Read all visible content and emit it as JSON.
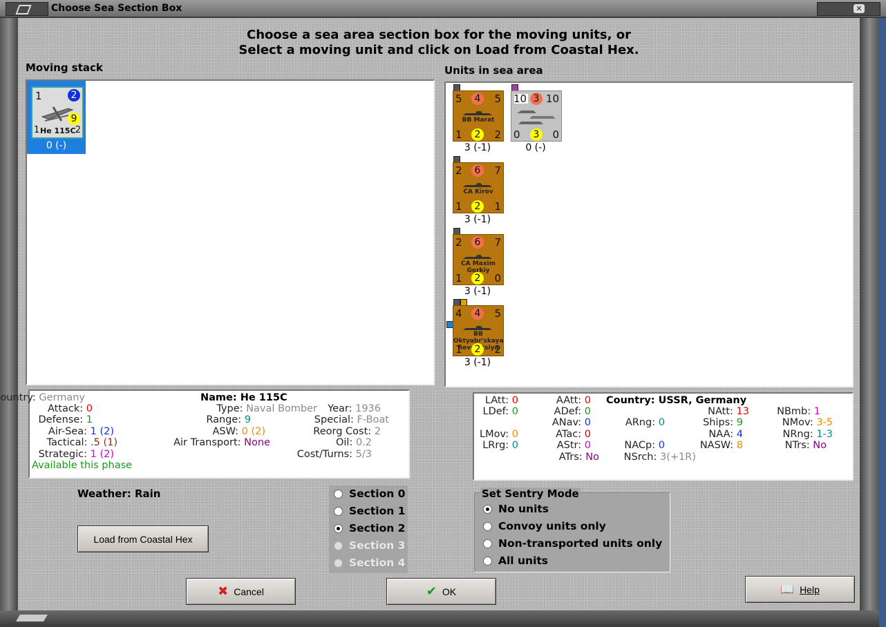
{
  "window": {
    "title": "Choose Sea Section Box"
  },
  "instructions": {
    "line1": "Choose a sea area section box for the moving units, or",
    "line2": "Select a moving unit and click on Load from Coastal Hex."
  },
  "moving_stack": {
    "label": "Moving stack",
    "unit": {
      "top_left": "1",
      "top_right": "2",
      "mid": "9",
      "bottom_left": "1",
      "name": "He 115C",
      "bottom_right": "2",
      "caption": "0 (-)"
    }
  },
  "sea_area": {
    "label": "Units in sea area",
    "units": [
      {
        "tl": "5",
        "tc": "4",
        "tr": "5",
        "name": "BB Marat",
        "bl": "1",
        "bc": "2",
        "br": "2",
        "caption": "3 (-1)"
      },
      {
        "tl": "10",
        "tc": "3",
        "tr": "10",
        "name": "",
        "bl": "0",
        "bc": "3",
        "br": "0",
        "caption": "0 (-)"
      },
      {
        "tl": "2",
        "tc": "6",
        "tr": "7",
        "name": "CA Kirov",
        "bl": "1",
        "bc": "2",
        "br": "1",
        "caption": "3 (-1)"
      },
      {
        "tl": "2",
        "tc": "6",
        "tr": "7",
        "name": "CA Maxim Gorkiy",
        "bl": "1",
        "bc": "2",
        "br": "0",
        "caption": "3 (-1)"
      },
      {
        "tl": "4",
        "tc": "4",
        "tr": "5",
        "name": "BB Oktyabr'skaya Revolutsiya",
        "bl": "1",
        "bc": "2",
        "br": "2",
        "caption": "3 (-1)"
      }
    ]
  },
  "unit_info": {
    "country_label": "Country:",
    "country": "Germany",
    "attack_label": "Attack:",
    "attack": "0",
    "defense_label": "Defense:",
    "defense": "1",
    "airsea_label": "Air-Sea:",
    "airsea_a": "1",
    "airsea_b": "(2)",
    "tactical_label": "Tactical:",
    "tactical_a": ".5",
    "tactical_b": "(1)",
    "strategic_label": "Strategic:",
    "strategic_a": "1",
    "strategic_b": "(2)",
    "available": "Available this phase",
    "name_label": "Name:",
    "name": "He 115C",
    "type_label": "Type:",
    "type": "Naval Bomber",
    "year_label": "Year:",
    "year": "1936",
    "range_label": "Range:",
    "range": "9",
    "special_label": "Special:",
    "special": "F-Boat",
    "asw_label": "ASW:",
    "asw_a": "0",
    "asw_b": "(2)",
    "reorg_label": "Reorg Cost:",
    "reorg": "2",
    "airtransport_label": "Air Transport:",
    "airtransport": "None",
    "oil_label": "Oil:",
    "oil": "0.2",
    "costturns_label": "Cost/Turns:",
    "costturns": "5/3"
  },
  "area_info": {
    "latt_label": "LAtt:",
    "latt": "0",
    "ldef_label": "LDef:",
    "ldef": "0",
    "lmov_label": "LMov:",
    "lmov": "0",
    "lrng_label": "LRrg:",
    "lrng": "0",
    "aatt_label": "AAtt:",
    "aatt": "0",
    "adef_label": "ADef:",
    "adef": "0",
    "anav_label": "ANav:",
    "anav": "0",
    "atac_label": "ATac:",
    "atac": "0",
    "astr_label": "AStr:",
    "astr": "0",
    "atrs_label": "ATrs:",
    "atrs": "No",
    "country_label": "Country:",
    "country": "USSR, Germany",
    "arng_label": "ARng:",
    "arng": "0",
    "nacp_label": "NACp:",
    "nacp": "0",
    "nsrch_label": "NSrch:",
    "nsrch": "3(+1R)",
    "natt_label": "NAtt:",
    "natt": "13",
    "ships_label": "Ships:",
    "ships": "9",
    "naa_label": "NAA:",
    "naa": "4",
    "nasw_label": "NASW:",
    "nasw": "8",
    "nbmb_label": "NBmb:",
    "nbmb": "1",
    "nmov_label": "NMov:",
    "nmov": "3-5",
    "nrng_label": "NRng:",
    "nrng": "1-3",
    "ntrs_label": "NTrs:",
    "ntrs": "No"
  },
  "weather": "Weather: Rain",
  "load_button": "Load from Coastal Hex",
  "sections": [
    {
      "label": "Section 0",
      "selected": false,
      "enabled": true
    },
    {
      "label": "Section 1",
      "selected": false,
      "enabled": true
    },
    {
      "label": "Section 2",
      "selected": true,
      "enabled": true
    },
    {
      "label": "Section 3",
      "selected": false,
      "enabled": false
    },
    {
      "label": "Section 4",
      "selected": false,
      "enabled": false
    }
  ],
  "sentry": {
    "title": "Set Sentry Mode",
    "options": [
      {
        "label": "No units",
        "selected": true
      },
      {
        "label": "Convoy units only",
        "selected": false
      },
      {
        "label": "Non-transported units only",
        "selected": false
      },
      {
        "label": "All units",
        "selected": false
      }
    ]
  },
  "buttons": {
    "cancel": "Cancel",
    "ok": "OK",
    "help": "Help"
  },
  "colors": {
    "selection": "#1f7fe0",
    "counter_brown": "#b8760f",
    "counter_grey": "#c2c2c2",
    "attack_circle": "#f07050",
    "yellow_circle": "#ffff00",
    "blue_circle": "#1030e0"
  },
  "icons": {
    "cancel": "red-x-icon",
    "ok": "green-check-icon",
    "help": "help-book-icon"
  }
}
